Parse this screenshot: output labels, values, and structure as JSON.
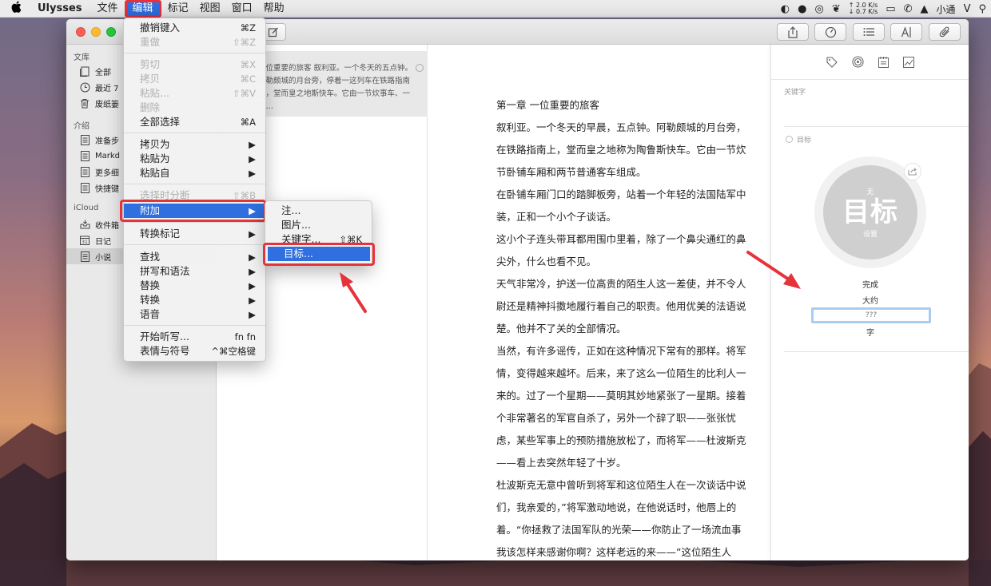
{
  "menubar": {
    "apple": "",
    "items": [
      "Ulysses",
      "文件",
      "编辑",
      "标记",
      "视图",
      "窗口",
      "帮助"
    ],
    "net_up": "↑ 2.0 K/s",
    "net_down": "↓ 0.7 K/s",
    "user": "小通"
  },
  "library": {
    "section_library": "文库",
    "items_library": [
      "全部",
      "最近 7",
      "废纸篓"
    ],
    "section_intro": "介绍",
    "items_intro": [
      "准备步",
      "Markd",
      "更多细",
      "快捷键"
    ],
    "section_icloud": "iCloud",
    "items_icloud": [
      "收件箱",
      "日记",
      "小说"
    ]
  },
  "sheet": {
    "preview": "一位重要的旅客 叙利亚。一个冬天的五点钟。阿勒颇城的月台旁，停着一这列车在铁路指南上，堂而皇之地斯快车。它由一节炊事车、一节…"
  },
  "editor": {
    "lines": [
      "第一章 一位重要的旅客",
      "叙利亚。一个冬天的早晨，五点钟。阿勒颇城的月台旁，",
      "在铁路指南上，堂而皇之地称为陶鲁斯快车。它由一节炊",
      "节卧铺车厢和两节普通客车组成。",
      "在卧铺车厢门口的踏脚板旁，站着一个年轻的法国陆军中",
      "装，正和一个小个子谈话。",
      "这小个子连头带耳都用围巾里着，除了一个鼻尖通红的鼻",
      "尖外，什么也看不见。",
      "天气非常冷，护送一位高贵的陌生人这一差使，并不令人",
      "尉还是精神抖擞地履行着自己的职责。他用优美的法语说",
      "楚。他并不了关的全部情况。",
      "当然，有许多谣传，正如在这种情况下常有的那样。将军",
      "情，变得越来越坏。后来，来了这么一位陌生的比利人一",
      "来的。过了一个星期——莫明其妙地紧张了一星期。接着",
      "个非常著名的军官自杀了，另外一个辞了职——张张忧",
      "虑，某些军事上的预防措施放松了，而将军——杜波斯克",
      "——看上去突然年轻了十岁。",
      "杜波斯克无意中曾听到将军和这位陌生人在一次谈话中说",
      "们，我亲爱的，”将军激动地说，在他说话时，他唇上的",
      "着。“你拯救了法国军队的光荣——你防止了一场流血事",
      "我该怎样来感谢你啊？这样老远的来——”这位陌生人"
    ]
  },
  "rightpanel": {
    "keywords_label": "关键字",
    "goal_label": "目标",
    "goal_none": "无",
    "goal_big": "目标",
    "goal_set": "设置",
    "done": "完成",
    "approx": "大约",
    "input_placeholder": "???",
    "unit": "字"
  },
  "edit_menu": {
    "undo": "撤销键入",
    "undo_sc": "⌘Z",
    "redo": "重做",
    "redo_sc": "⇧⌘Z",
    "cut": "剪切",
    "cut_sc": "⌘X",
    "copy": "拷贝",
    "copy_sc": "⌘C",
    "paste": "粘贴...",
    "paste_sc": "⇧⌘V",
    "delete": "删除",
    "select_all": "全部选择",
    "select_all_sc": "⌘A",
    "copy_as": "拷贝为",
    "paste_as": "粘贴为",
    "paste_from": "粘贴自",
    "split": "选择时分断",
    "split_sc": "⇧⌘B",
    "attach": "附加",
    "convert_markup": "转换标记",
    "find": "查找",
    "spelling": "拼写和语法",
    "substitutions": "替换",
    "transformations": "转换",
    "speech": "语音",
    "dictation": "开始听写...",
    "dictation_sc": "fn fn",
    "emoji": "表情与符号",
    "emoji_sc": "^⌘空格键",
    "arrow": "▶"
  },
  "attach_menu": {
    "note": "注...",
    "image": "图片...",
    "keyword": "关键字...",
    "keyword_sc": "⇧⌘K",
    "goal": "目标..."
  },
  "colors": {
    "accent": "#2f6fe0",
    "highlight_box": "#e6323b",
    "goal_circle": "#cfcfcf",
    "input_focus": "#a9cdf0"
  }
}
